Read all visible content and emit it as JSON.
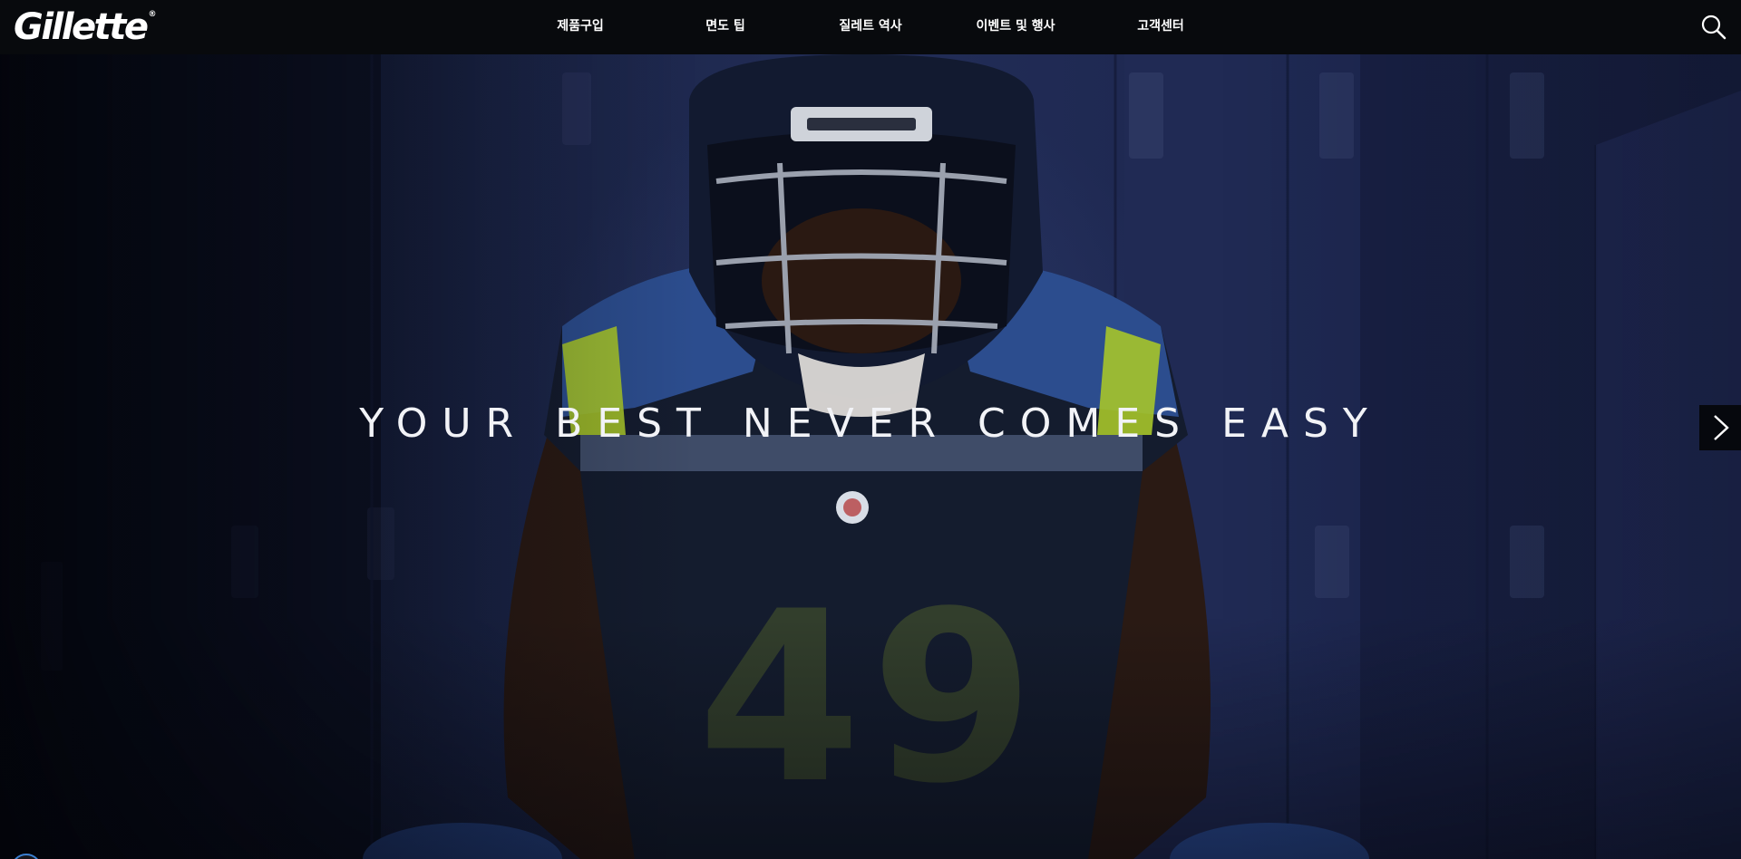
{
  "header": {
    "logo_text": "Gillette",
    "logo_mark": "®",
    "nav": [
      {
        "label": "제품구입"
      },
      {
        "label": "면도 팁"
      },
      {
        "label": "질레트 역사"
      },
      {
        "label": "이벤트 및 행사"
      },
      {
        "label": "고객센터"
      }
    ],
    "search_icon": "search-icon"
  },
  "hero": {
    "headline": "YOUR BEST NEVER COMES EASY",
    "jersey_number": "49",
    "next_icon": "chevron-right-icon"
  },
  "colors": {
    "header_bg": "#080a0d",
    "hero_navy": "#1b2548",
    "jersey_blue": "#2c4d8e",
    "neon_green": "#a6c52a",
    "text_white": "#ffffff"
  }
}
